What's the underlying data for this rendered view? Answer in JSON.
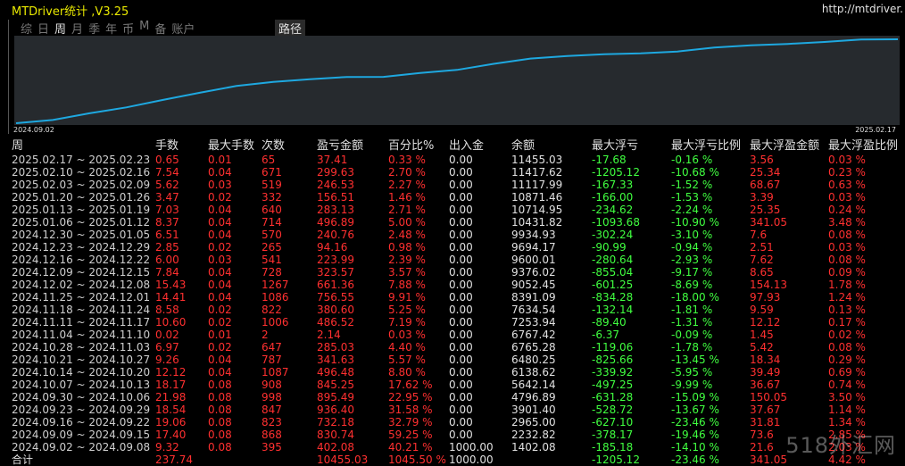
{
  "app": {
    "title": "MTDriver统计 ,V3.25",
    "url": "http://mtdriver."
  },
  "tabs": [
    {
      "label": "综"
    },
    {
      "label": "日"
    },
    {
      "label": "周",
      "active": true
    },
    {
      "label": "月"
    },
    {
      "label": "季"
    },
    {
      "label": "年"
    },
    {
      "label": "币"
    },
    {
      "label": "M"
    },
    {
      "label": "备"
    },
    {
      "label": "账户"
    }
  ],
  "path_tab": "路径",
  "chart": {
    "start_date": "2024.09.02",
    "end_date": "2025.02.17",
    "line_color": "#1ea8e0"
  },
  "columns": [
    "周",
    "手数",
    "最大手数",
    "次数",
    "盈亏金额",
    "百分比%",
    "出入金",
    "余额",
    "最大浮亏",
    "最大浮亏比例",
    "最大浮盈金额",
    "最大浮盈比例"
  ],
  "rows": [
    [
      "2025.02.17 ~ 2025.02.23",
      "0.65",
      "0.01",
      "65",
      "37.41",
      "0.33 %",
      "0.00",
      "11455.03",
      "-17.68",
      "-0.16 %",
      "3.56",
      "0.03 %"
    ],
    [
      "2025.02.10 ~ 2025.02.16",
      "7.54",
      "0.04",
      "671",
      "299.63",
      "2.70 %",
      "0.00",
      "11417.62",
      "-1205.12",
      "-10.68 %",
      "25.34",
      "0.23 %"
    ],
    [
      "2025.02.03 ~ 2025.02.09",
      "5.62",
      "0.03",
      "519",
      "246.53",
      "2.27 %",
      "0.00",
      "11117.99",
      "-167.33",
      "-1.52 %",
      "68.67",
      "0.63 %"
    ],
    [
      "2025.01.20 ~ 2025.01.26",
      "3.47",
      "0.02",
      "332",
      "156.51",
      "1.46 %",
      "0.00",
      "10871.46",
      "-166.00",
      "-1.53 %",
      "3.39",
      "0.03 %"
    ],
    [
      "2025.01.13 ~ 2025.01.19",
      "7.03",
      "0.04",
      "640",
      "283.13",
      "2.71 %",
      "0.00",
      "10714.95",
      "-234.62",
      "-2.24 %",
      "25.35",
      "0.24 %"
    ],
    [
      "2025.01.06 ~ 2025.01.12",
      "8.37",
      "0.04",
      "714",
      "496.89",
      "5.00 %",
      "0.00",
      "10431.82",
      "-1093.68",
      "-10.90 %",
      "341.05",
      "3.48 %"
    ],
    [
      "2024.12.30 ~ 2025.01.05",
      "6.51",
      "0.04",
      "570",
      "240.76",
      "2.48 %",
      "0.00",
      "9934.93",
      "-302.24",
      "-3.10 %",
      "7.6",
      "0.08 %"
    ],
    [
      "2024.12.23 ~ 2024.12.29",
      "2.85",
      "0.02",
      "265",
      "94.16",
      "0.98 %",
      "0.00",
      "9694.17",
      "-90.99",
      "-0.94 %",
      "2.51",
      "0.03 %"
    ],
    [
      "2024.12.16 ~ 2024.12.22",
      "6.00",
      "0.03",
      "541",
      "223.99",
      "2.39 %",
      "0.00",
      "9600.01",
      "-280.64",
      "-2.93 %",
      "7.62",
      "0.08 %"
    ],
    [
      "2024.12.09 ~ 2024.12.15",
      "7.84",
      "0.04",
      "728",
      "323.57",
      "3.57 %",
      "0.00",
      "9376.02",
      "-855.04",
      "-9.17 %",
      "8.65",
      "0.09 %"
    ],
    [
      "2024.12.02 ~ 2024.12.08",
      "15.43",
      "0.04",
      "1267",
      "661.36",
      "7.88 %",
      "0.00",
      "9052.45",
      "-601.25",
      "-8.69 %",
      "154.13",
      "1.78 %"
    ],
    [
      "2024.11.25 ~ 2024.12.01",
      "14.41",
      "0.04",
      "1086",
      "756.55",
      "9.91 %",
      "0.00",
      "8391.09",
      "-834.28",
      "-18.00 %",
      "97.93",
      "1.24 %"
    ],
    [
      "2024.11.18 ~ 2024.11.24",
      "8.58",
      "0.02",
      "822",
      "380.60",
      "5.25 %",
      "0.00",
      "7634.54",
      "-132.14",
      "-1.81 %",
      "9.59",
      "0.13 %"
    ],
    [
      "2024.11.11 ~ 2024.11.17",
      "10.60",
      "0.02",
      "1006",
      "486.52",
      "7.19 %",
      "0.00",
      "7253.94",
      "-89.40",
      "-1.31 %",
      "12.12",
      "0.17 %"
    ],
    [
      "2024.11.04 ~ 2024.11.10",
      "0.02",
      "0.01",
      "2",
      "2.14",
      "0.03 %",
      "0.00",
      "6767.42",
      "-6.37",
      "-0.09 %",
      "1.45",
      "0.02 %"
    ],
    [
      "2024.10.28 ~ 2024.11.03",
      "6.97",
      "0.02",
      "647",
      "285.03",
      "4.40 %",
      "0.00",
      "6765.28",
      "-119.06",
      "-1.78 %",
      "5.42",
      "0.08 %"
    ],
    [
      "2024.10.21 ~ 2024.10.27",
      "9.26",
      "0.04",
      "787",
      "341.63",
      "5.57 %",
      "0.00",
      "6480.25",
      "-825.66",
      "-13.45 %",
      "18.34",
      "0.29 %"
    ],
    [
      "2024.10.14 ~ 2024.10.20",
      "12.12",
      "0.04",
      "1087",
      "496.48",
      "8.80 %",
      "0.00",
      "6138.62",
      "-339.92",
      "-5.95 %",
      "39.49",
      "0.69 %"
    ],
    [
      "2024.10.07 ~ 2024.10.13",
      "18.17",
      "0.08",
      "908",
      "845.25",
      "17.62 %",
      "0.00",
      "5642.14",
      "-497.25",
      "-9.99 %",
      "36.67",
      "0.74 %"
    ],
    [
      "2024.09.30 ~ 2024.10.06",
      "21.98",
      "0.08",
      "998",
      "895.49",
      "22.95 %",
      "0.00",
      "4796.89",
      "-631.28",
      "-15.09 %",
      "150.05",
      "3.50 %"
    ],
    [
      "2024.09.23 ~ 2024.09.29",
      "18.54",
      "0.08",
      "847",
      "936.40",
      "31.58 %",
      "0.00",
      "3901.40",
      "-528.72",
      "-13.67 %",
      "37.67",
      "1.14 %"
    ],
    [
      "2024.09.16 ~ 2024.09.22",
      "19.06",
      "0.08",
      "823",
      "732.18",
      "32.79 %",
      "0.00",
      "2965.00",
      "-627.10",
      "-23.46 %",
      "31.81",
      "1.34 %"
    ],
    [
      "2024.09.09 ~ 2024.09.15",
      "17.40",
      "0.08",
      "868",
      "830.74",
      "59.25 %",
      "0.00",
      "2232.82",
      "-378.17",
      "-19.46 %",
      "73.6",
      "2.85 %"
    ],
    [
      "2024.09.02 ~ 2024.09.08",
      "9.32",
      "0.08",
      "395",
      "402.08",
      "40.21 %",
      "1000.00",
      "1402.08",
      "-185.18",
      "-14.10 %",
      "21.6",
      "2.03 %"
    ]
  ],
  "total": [
    "合计",
    "237.74",
    "",
    "",
    "10455.03",
    "1045.50 %",
    "1000.00",
    "",
    "-1205.12",
    "-23.46 %",
    "341.05",
    "4.42 %"
  ],
  "watermark": "518外汇网"
}
